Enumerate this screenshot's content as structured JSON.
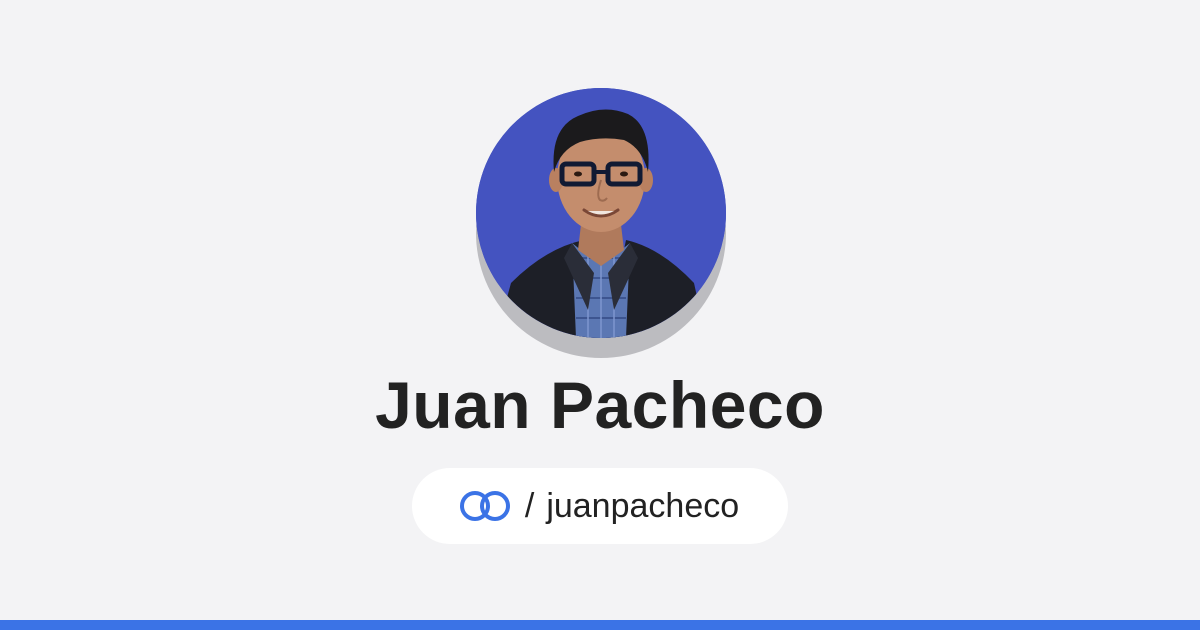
{
  "profile": {
    "name": "Juan Pacheco",
    "separator": "/",
    "handle": "juanpacheco",
    "avatar_icon": "profile-photo",
    "brand_icon": "linked-rings-icon"
  },
  "colors": {
    "background": "#f3f3f5",
    "avatar_background": "#4453c0",
    "avatar_shadow": "#bcbcc0",
    "text": "#222222",
    "accent": "#3b73e6",
    "pill_background": "#ffffff"
  }
}
